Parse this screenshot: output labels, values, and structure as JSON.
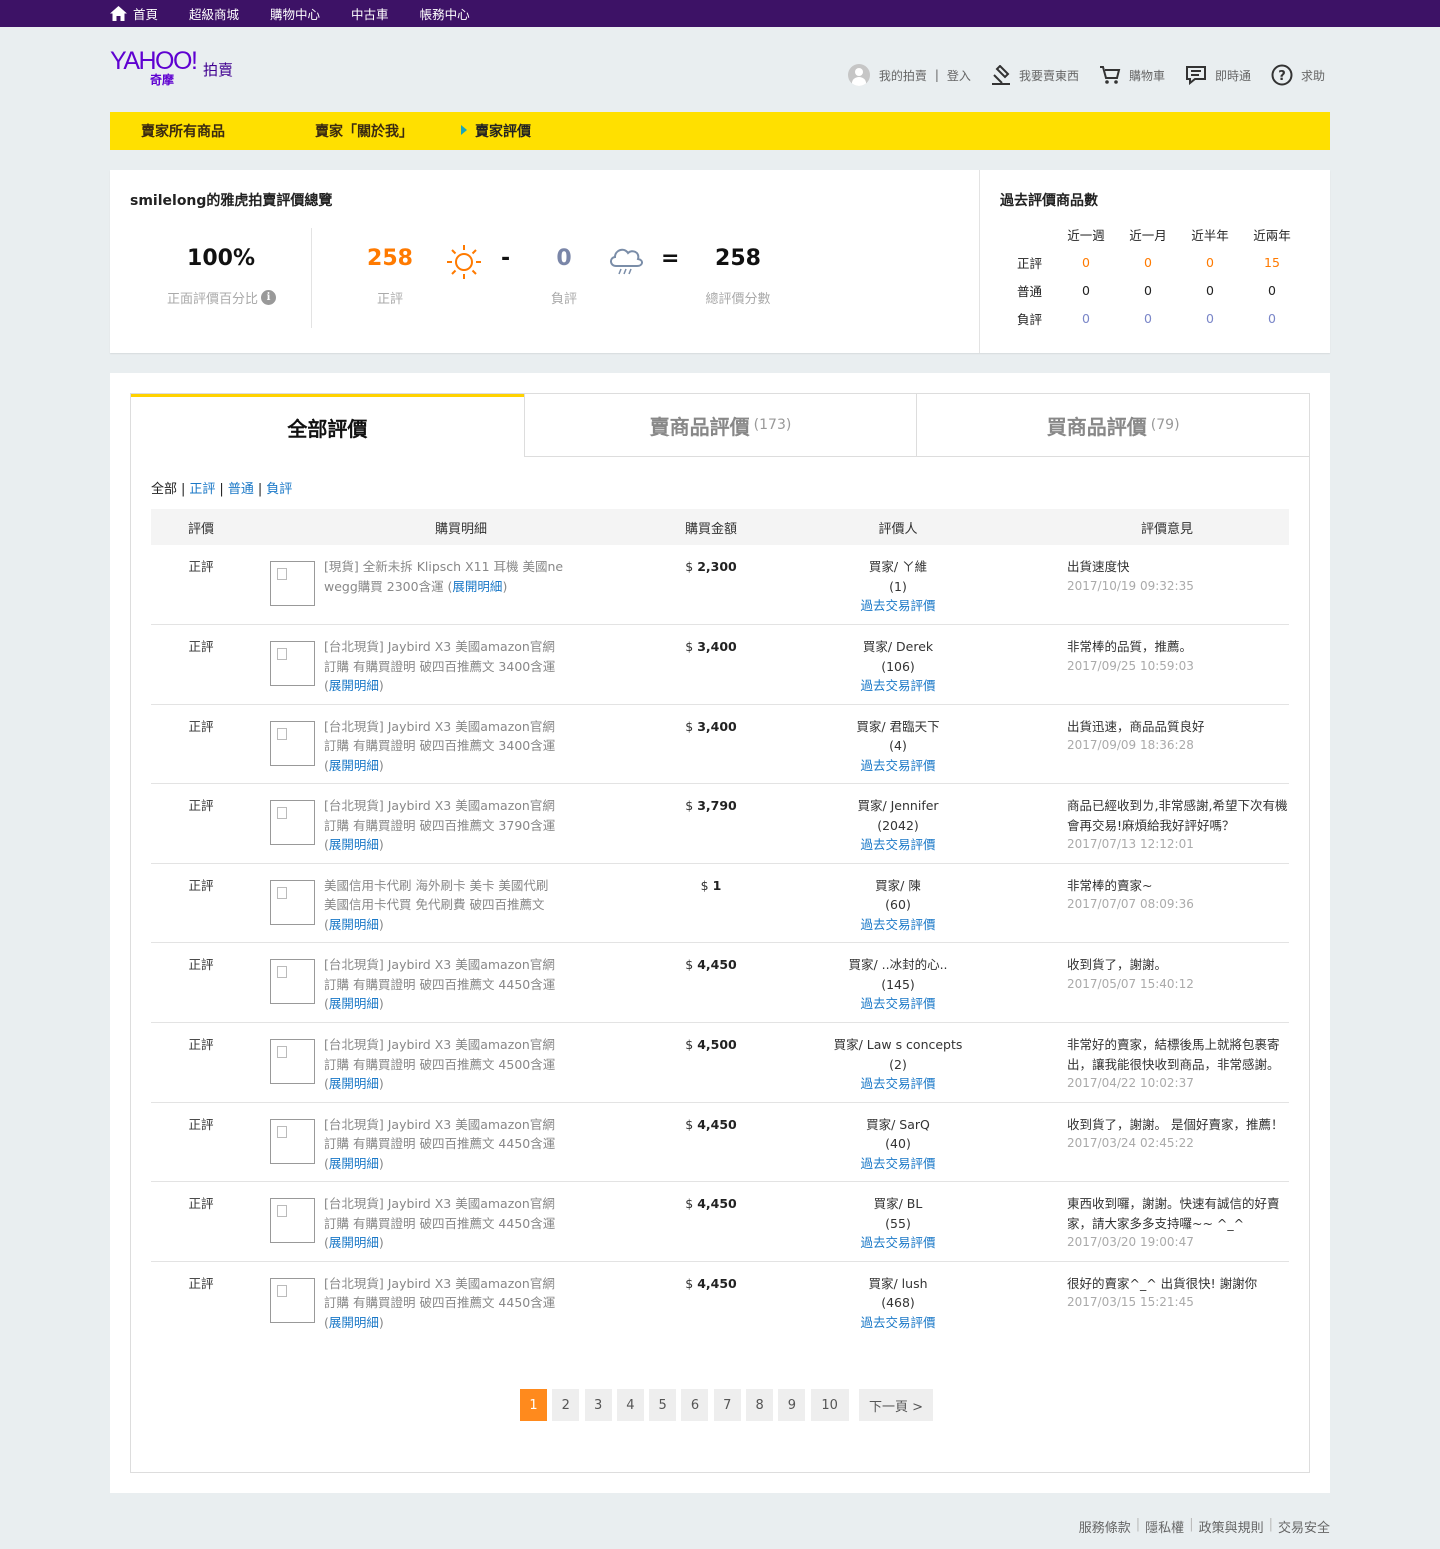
{
  "topbar": {
    "items": [
      "首頁",
      "超級商城",
      "購物中心",
      "中古車",
      "帳務中心"
    ]
  },
  "logo": {
    "brand": "YAHOO!",
    "cn": "奇摩",
    "sub": "拍賣"
  },
  "header": {
    "my_auction": "我的拍賣",
    "sep": "|",
    "login": "登入",
    "sell": "我要賣東西",
    "cart": "購物車",
    "im": "即時通",
    "help": "求助"
  },
  "subnav": {
    "items": [
      "賣家所有商品",
      "賣家「關於我」",
      "賣家評價"
    ]
  },
  "summary": {
    "title": "smilelong的雅虎拍賣評價總覽",
    "percent": "100%",
    "percent_label": "正面評價百分比",
    "positive": "258",
    "positive_label": "正評",
    "minus": "-",
    "negative": "0",
    "negative_label": "負評",
    "equals": "=",
    "total": "258",
    "total_label": "總評價分數"
  },
  "past": {
    "title": "過去評價商品數",
    "cols": [
      "近一週",
      "近一月",
      "近半年",
      "近兩年"
    ],
    "rows": [
      {
        "label": "正評",
        "vals": [
          "0",
          "0",
          "0",
          "15"
        ]
      },
      {
        "label": "普通",
        "vals": [
          "0",
          "0",
          "0",
          "0"
        ]
      },
      {
        "label": "負評",
        "vals": [
          "0",
          "0",
          "0",
          "0"
        ]
      }
    ]
  },
  "tabs": [
    {
      "label": "全部評價",
      "count": ""
    },
    {
      "label": "賣商品評價",
      "count": "(173)"
    },
    {
      "label": "買商品評價",
      "count": "(79)"
    }
  ],
  "filters": {
    "all": "全部",
    "pos": "正評",
    "neu": "普通",
    "neg": "負評",
    "sep": "|"
  },
  "table": {
    "headers": [
      "評價",
      "購買明細",
      "購買金額",
      "評價人",
      "評價意見"
    ],
    "expand": "展開明細",
    "past_link": "過去交易評價",
    "rows": [
      {
        "rate": "正評",
        "item": "[現貨] 全新未拆 Klipsch X11 耳機 美國ne wegg購買 2300含運 (",
        "cur": "$",
        "amt": "2,300",
        "rater": "買家/ ㄚ維",
        "score": "(1)",
        "comment": "出貨速度快",
        "date": "2017/10/19 09:32:35"
      },
      {
        "rate": "正評",
        "item": "[台北現貨] Jaybird X3 美國amazon官網訂購 有購買證明 破四百推薦文 3400含運 (",
        "cur": "$",
        "amt": "3,400",
        "rater": "買家/ Derek",
        "score": "(106)",
        "comment": "非常棒的品質，推薦。",
        "date": "2017/09/25 10:59:03"
      },
      {
        "rate": "正評",
        "item": "[台北現貨] Jaybird X3 美國amazon官網訂購 有購買證明 破四百推薦文 3400含運 (",
        "cur": "$",
        "amt": "3,400",
        "rater": "買家/ 君臨天下",
        "score": "(4)",
        "comment": "出貨迅速，商品品質良好",
        "date": "2017/09/09 18:36:28"
      },
      {
        "rate": "正評",
        "item": "[台北現貨] Jaybird X3 美國amazon官網訂購 有購買證明 破四百推薦文 3790含運 (",
        "cur": "$",
        "amt": "3,790",
        "rater": "買家/ Jennifer",
        "score": "(2042)",
        "comment": "商品已經收到ㄌ,非常感謝,希望下次有機會再交易!麻煩給我好評好嗎？",
        "date": "2017/07/13 12:12:01"
      },
      {
        "rate": "正評",
        "item": "美國信用卡代刷 海外刷卡 美卡 美國代刷 美國信用卡代買 免代刷費 破四百推薦文 (",
        "cur": "$",
        "amt": "1",
        "rater": "買家/ 陳",
        "score": "(60)",
        "comment": "非常棒的賣家~",
        "date": "2017/07/07 08:09:36"
      },
      {
        "rate": "正評",
        "item": "[台北現貨] Jaybird X3 美國amazon官網訂購 有購買證明 破四百推薦文 4450含運 (",
        "cur": "$",
        "amt": "4,450",
        "rater": "買家/ ..冰封的心..",
        "score": "(145)",
        "comment": "收到貨了，謝謝。",
        "date": "2017/05/07 15:40:12"
      },
      {
        "rate": "正評",
        "item": "[台北現貨] Jaybird X3 美國amazon官網訂購 有購買證明 破四百推薦文 4500含運 (",
        "cur": "$",
        "amt": "4,500",
        "rater": "買家/ Law s concepts",
        "score": "(2)",
        "comment": "非常好的賣家，結標後馬上就將包裹寄出，讓我能很快收到商品，非常感謝。",
        "date": "2017/04/22 10:02:37"
      },
      {
        "rate": "正評",
        "item": "[台北現貨] Jaybird X3 美國amazon官網訂購 有購買證明 破四百推薦文 4450含運 (",
        "cur": "$",
        "amt": "4,450",
        "rater": "買家/ SarQ",
        "score": "(40)",
        "comment": "收到貨了，謝謝。 是個好賣家，推薦！",
        "date": "2017/03/24 02:45:22"
      },
      {
        "rate": "正評",
        "item": "[台北現貨] Jaybird X3 美國amazon官網訂購 有購買證明 破四百推薦文 4450含運 (",
        "cur": "$",
        "amt": "4,450",
        "rater": "買家/ BL",
        "score": "(55)",
        "comment": "東西收到囉，謝謝。快速有誠信的好賣家，請大家多多支持囉~~ ^_^",
        "date": "2017/03/20 19:00:47"
      },
      {
        "rate": "正評",
        "item": "[台北現貨] Jaybird X3 美國amazon官網訂購 有購買證明 破四百推薦文 4450含運 (",
        "cur": "$",
        "amt": "4,450",
        "rater": "買家/ lush",
        "score": "(468)",
        "comment": "很好的賣家^_^ 出貨很快! 謝謝你",
        "date": "2017/03/15 15:21:45"
      }
    ]
  },
  "pager": {
    "pages": [
      "1",
      "2",
      "3",
      "4",
      "5",
      "6",
      "7",
      "8",
      "9",
      "10"
    ],
    "current": "1",
    "next": "下一頁 >"
  },
  "footer": {
    "links": [
      "服務條款",
      "隱私權",
      "政策與規則",
      "交易安全"
    ],
    "sep": "|"
  },
  "colors": {
    "topbar": "#3d1266",
    "subnav": "#ffe000",
    "positive": "#ff7a00",
    "negative": "#7a86c8",
    "link": "#1a78c7",
    "pager_active": "#ff8a1d",
    "tab_active_border": "#ffd200"
  }
}
